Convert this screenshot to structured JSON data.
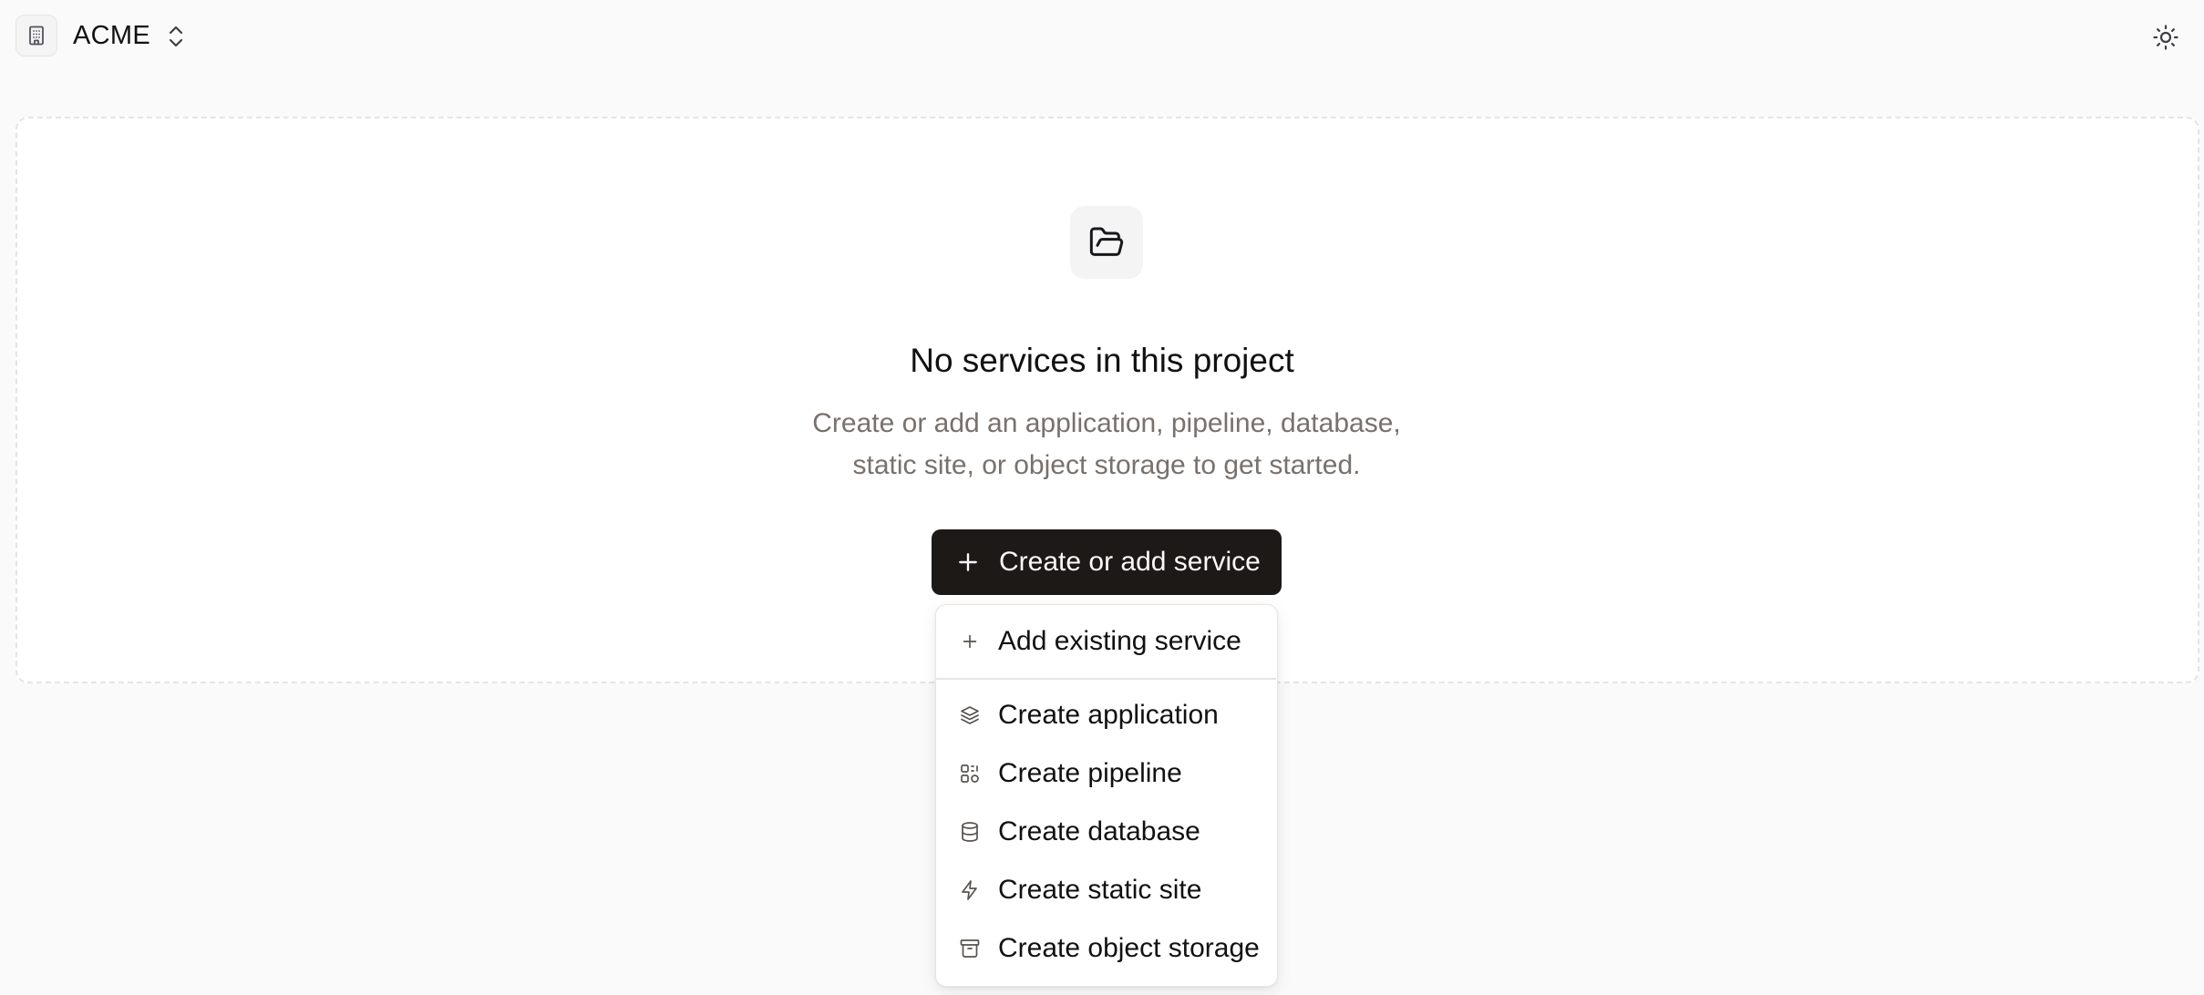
{
  "header": {
    "org_name": "ACME",
    "org_icon": "building-icon",
    "switch_icon": "chevrons-up-down-icon",
    "theme_icon": "sun-icon"
  },
  "empty_state": {
    "icon": "folder-open-icon",
    "title": "No services in this project",
    "description_line1": "Create or add an application, pipeline, database,",
    "description_line2": "static site, or object storage to get started."
  },
  "primary_action": {
    "label": "Create or add service",
    "icon": "plus-icon"
  },
  "menu": {
    "items": [
      {
        "label": "Add existing service",
        "icon": "plus-icon"
      },
      {
        "label": "Create application",
        "icon": "layers-icon"
      },
      {
        "label": "Create pipeline",
        "icon": "workflow-icon"
      },
      {
        "label": "Create database",
        "icon": "database-icon"
      },
      {
        "label": "Create static site",
        "icon": "zap-icon"
      },
      {
        "label": "Create object storage",
        "icon": "archive-icon"
      }
    ]
  },
  "colors": {
    "background": "#fafafa",
    "primary_button": "#1c1917",
    "muted_text": "#78716c"
  }
}
